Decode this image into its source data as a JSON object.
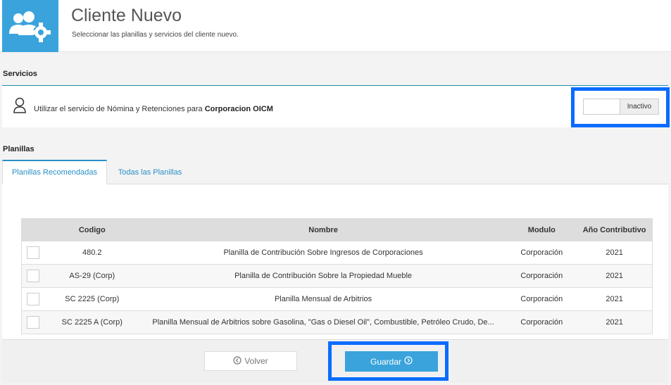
{
  "header": {
    "icon": "users-gear-icon",
    "title": "Cliente Nuevo",
    "subtitle": "Seleccionar las planillas y servicios del cliente nuevo."
  },
  "servicios": {
    "label": "Servicios",
    "icon": "user-outline-icon",
    "text": "Utilizar el servicio de Nómina y Retenciones para ",
    "company": "Corporacion OICM",
    "toggle_label": "Inactivo"
  },
  "planillas": {
    "label": "Planillas",
    "tabs": [
      {
        "label": "Planillas Recomendadas",
        "active": true
      },
      {
        "label": "Todas las Planillas",
        "active": false
      }
    ],
    "columns": [
      "Codigo",
      "Nombre",
      "Modulo",
      "Año Contributivo"
    ],
    "rows": [
      {
        "codigo": "480.2",
        "nombre": "Planilla de Contribución Sobre Ingresos de Corporaciones",
        "modulo": "Corporación",
        "anio": "2021"
      },
      {
        "codigo": "AS-29 (Corp)",
        "nombre": "Planilla de Contribución Sobre la Propiedad Mueble",
        "modulo": "Corporación",
        "anio": "2021"
      },
      {
        "codigo": "SC 2225 (Corp)",
        "nombre": "Planilla Mensual de Arbitrios",
        "modulo": "Corporación",
        "anio": "2021"
      },
      {
        "codigo": "SC 2225 A (Corp)",
        "nombre": "Planilla Mensual de Arbitrios sobre Gasolina, \"Gas o Diesel Oil\", Combustible, Petróleo Crudo, De...",
        "modulo": "Corporación",
        "anio": "2021"
      }
    ]
  },
  "footer": {
    "volver_label": "Volver",
    "guardar_label": "Guardar"
  },
  "colors": {
    "accent": "#3aa3dc",
    "highlight": "#0a6cff"
  }
}
